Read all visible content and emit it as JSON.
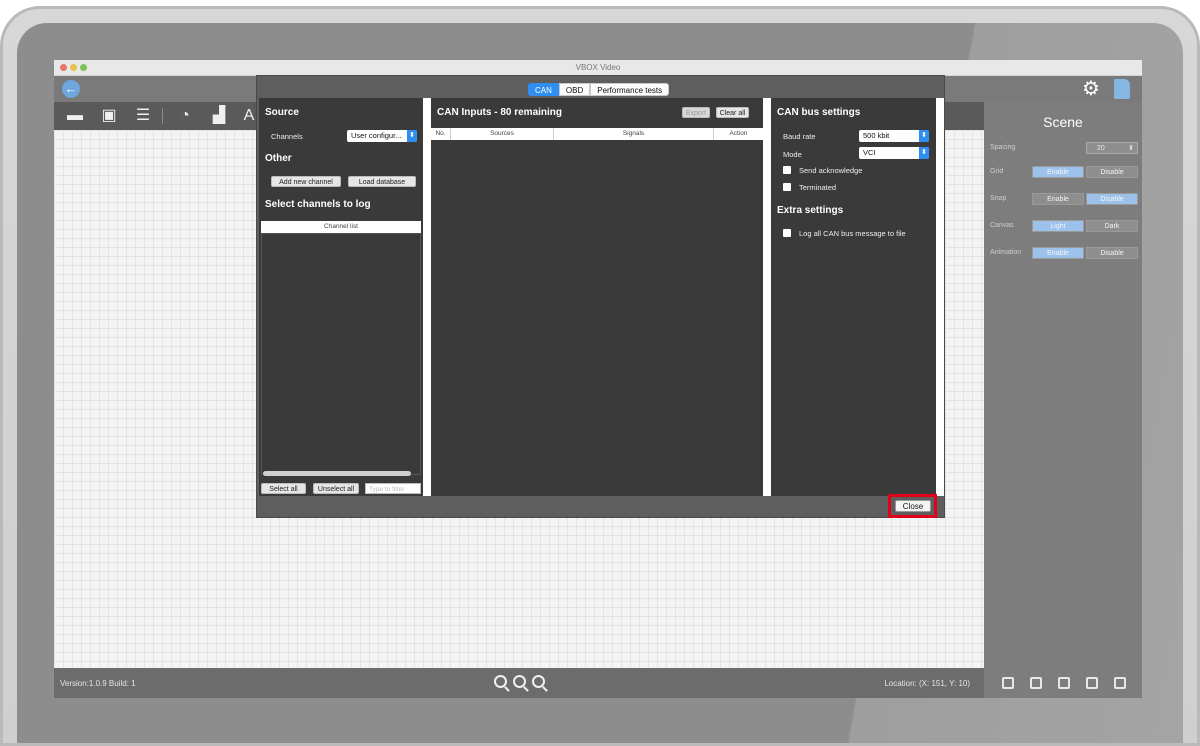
{
  "window": {
    "title": "VBOX Video"
  },
  "colors": {
    "accent": "#2f8ef1",
    "highlight": "#e3001b",
    "scene_selected": "#9cc2ec"
  },
  "toolbar": {
    "icons": [
      "back-arrow-icon",
      "folder-icon",
      "save-icon",
      "list-icon",
      "gauge-icon",
      "bar-chart-icon",
      "text-icon",
      "gear-icon",
      "sd-card-icon"
    ]
  },
  "dialog": {
    "tabs": [
      {
        "label": "CAN",
        "active": true
      },
      {
        "label": "OBD",
        "active": false
      },
      {
        "label": "Performance tests",
        "active": false
      }
    ],
    "source": {
      "heading": "Source",
      "channels_label": "Channels",
      "channels_value": "User configur...",
      "other_heading": "Other",
      "add_channel": "Add new channel",
      "load_database": "Load database",
      "select_heading": "Select channels to log",
      "channel_list_header": "Channel list",
      "select_all": "Select all",
      "unselect_all": "Unselect all",
      "filter_placeholder": "Type to filter"
    },
    "can_inputs": {
      "heading": "CAN Inputs - 80 remaining",
      "export": "Export",
      "clear_all": "Clear all",
      "columns": [
        "No.",
        "Sources",
        "Signals",
        "Action"
      ]
    },
    "can_bus": {
      "heading": "CAN bus settings",
      "baud_label": "Baud rate",
      "baud_value": "500 kbit",
      "mode_label": "Mode",
      "mode_value": "VCI",
      "send_ack": "Send acknowledge",
      "terminated": "Terminated",
      "extra_heading": "Extra settings",
      "log_all": "Log all CAN bus message to file"
    },
    "close": "Close"
  },
  "scene": {
    "title": "Scene",
    "spacing_label": "Spacing",
    "spacing_value": "20",
    "rows": [
      {
        "label": "Grid",
        "a": "Enable",
        "b": "Disable",
        "selected": "a"
      },
      {
        "label": "Snap",
        "a": "Enable",
        "b": "Disable",
        "selected": "b"
      },
      {
        "label": "Canvas",
        "a": "Light",
        "b": "Dark",
        "selected": "a"
      },
      {
        "label": "Animation",
        "a": "Enable",
        "b": "Disable",
        "selected": "a"
      }
    ]
  },
  "status": {
    "version": "Version:1.0.9 Build: 1",
    "location": "Location: (X: 151, Y: 10)"
  }
}
